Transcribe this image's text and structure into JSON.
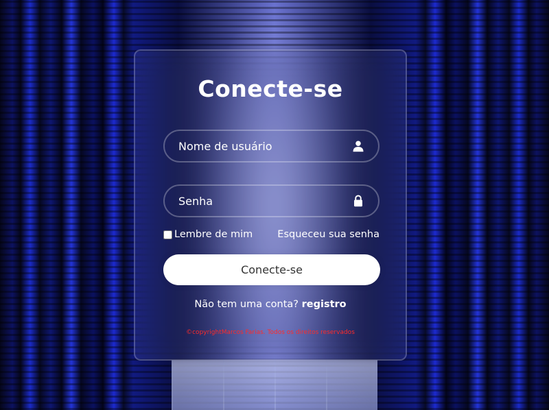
{
  "page": {
    "title": "Conecte-se"
  },
  "form": {
    "username_placeholder": "Nome de usuário",
    "username_icon": "user-icon",
    "password_placeholder": "Senha",
    "password_icon": "lock-icon",
    "remember_label": "Lembre de mim",
    "forgot_label": "Esqueceu sua senha",
    "submit_label": "Conecte-se",
    "register_prompt": "Não tem uma conta?",
    "register_link": "registro",
    "copyright": "©copyrightMarcos Farias. Todos os direitos reservados"
  },
  "colors": {
    "card_text": "#ffffff",
    "button_bg": "#ffffff",
    "button_text": "#333333",
    "copyright_text": "#ff2a2a"
  }
}
